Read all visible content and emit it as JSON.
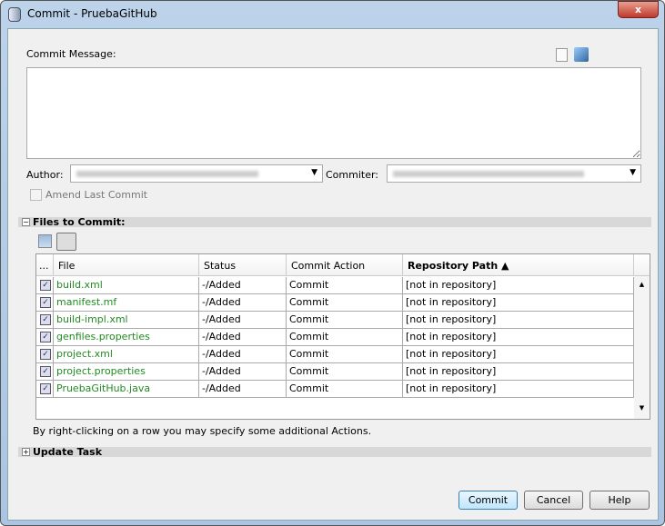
{
  "window": {
    "title": "Commit - PruebaGitHub",
    "close": "x"
  },
  "commit_message": {
    "label": "Commit Message:",
    "value": ""
  },
  "author": {
    "label": "Author:"
  },
  "committer": {
    "label": "Commiter:"
  },
  "amend": {
    "label": "Amend Last Commit",
    "checked": false
  },
  "files_section": {
    "title": "Files to Commit:",
    "toggle": "−"
  },
  "table": {
    "columns": [
      "...",
      "File",
      "Status",
      "Commit Action",
      "Repository Path ▲"
    ],
    "rows": [
      {
        "file": "build.xml",
        "status": "-/Added",
        "action": "Commit",
        "path": "[not in repository]",
        "checked": true
      },
      {
        "file": "manifest.mf",
        "status": "-/Added",
        "action": "Commit",
        "path": "[not in repository]",
        "checked": true
      },
      {
        "file": "build-impl.xml",
        "status": "-/Added",
        "action": "Commit",
        "path": "[not in repository]",
        "checked": true
      },
      {
        "file": "genfiles.properties",
        "status": "-/Added",
        "action": "Commit",
        "path": "[not in repository]",
        "checked": true
      },
      {
        "file": "project.xml",
        "status": "-/Added",
        "action": "Commit",
        "path": "[not in repository]",
        "checked": true
      },
      {
        "file": "project.properties",
        "status": "-/Added",
        "action": "Commit",
        "path": "[not in repository]",
        "checked": true
      },
      {
        "file": "PruebaGitHub.java",
        "status": "-/Added",
        "action": "Commit",
        "path": "[not in repository]",
        "checked": true
      }
    ]
  },
  "hint": "By right-clicking on a row you may specify some additional Actions.",
  "update_section": {
    "title": "Update Task",
    "toggle": "+"
  },
  "buttons": {
    "commit": "Commit",
    "cancel": "Cancel",
    "help": "Help"
  }
}
